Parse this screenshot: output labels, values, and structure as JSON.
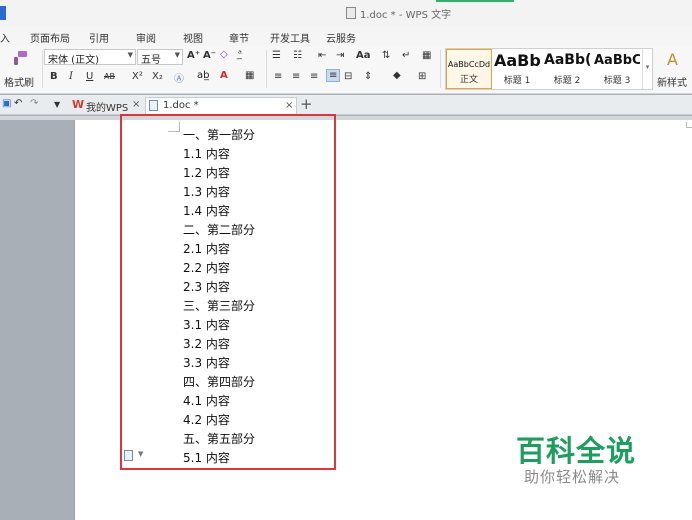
{
  "window": {
    "title": "1.doc * - WPS 文字"
  },
  "menu": [
    "入",
    "页面布局",
    "引用",
    "审阅",
    "视图",
    "章节",
    "开发工具",
    "云服务"
  ],
  "ribbon": {
    "format_painter": "格式刷",
    "font_name": "宋体 (正文)",
    "font_size": "五号",
    "styles": [
      {
        "preview": "AaBbCcDd",
        "label": "正文"
      },
      {
        "preview": "AaBb",
        "label": "标题 1"
      },
      {
        "preview": "AaBb(",
        "label": "标题 2"
      },
      {
        "preview": "AaBbC",
        "label": "标题 3"
      }
    ],
    "new_style": "新样式",
    "new_style_icon": "A"
  },
  "tabs": [
    {
      "label": "我的WPS",
      "close": "×"
    },
    {
      "label": "1.doc *",
      "close": "×"
    }
  ],
  "new_tab": "+",
  "document": {
    "lines": [
      "一、第一部分",
      "1.1 内容",
      "1.2 内容",
      "1.3 内容",
      "1.4 内容",
      "二、第二部分",
      "2.1 内容",
      "2.2 内容",
      "2.3 内容",
      "三、第三部分",
      "3.1 内容",
      "3.2 内容",
      "3.3 内容",
      "四、第四部分",
      "4.1 内容",
      "4.2 内容",
      "五、第五部分",
      "5.1 内容"
    ]
  },
  "watermark": {
    "title": "百科全说",
    "subtitle": "助你轻松解决"
  },
  "colors": {
    "highlight": "#d9363e",
    "brand_green": "#1e9e5e",
    "accent_blue": "#2d6bd1"
  }
}
